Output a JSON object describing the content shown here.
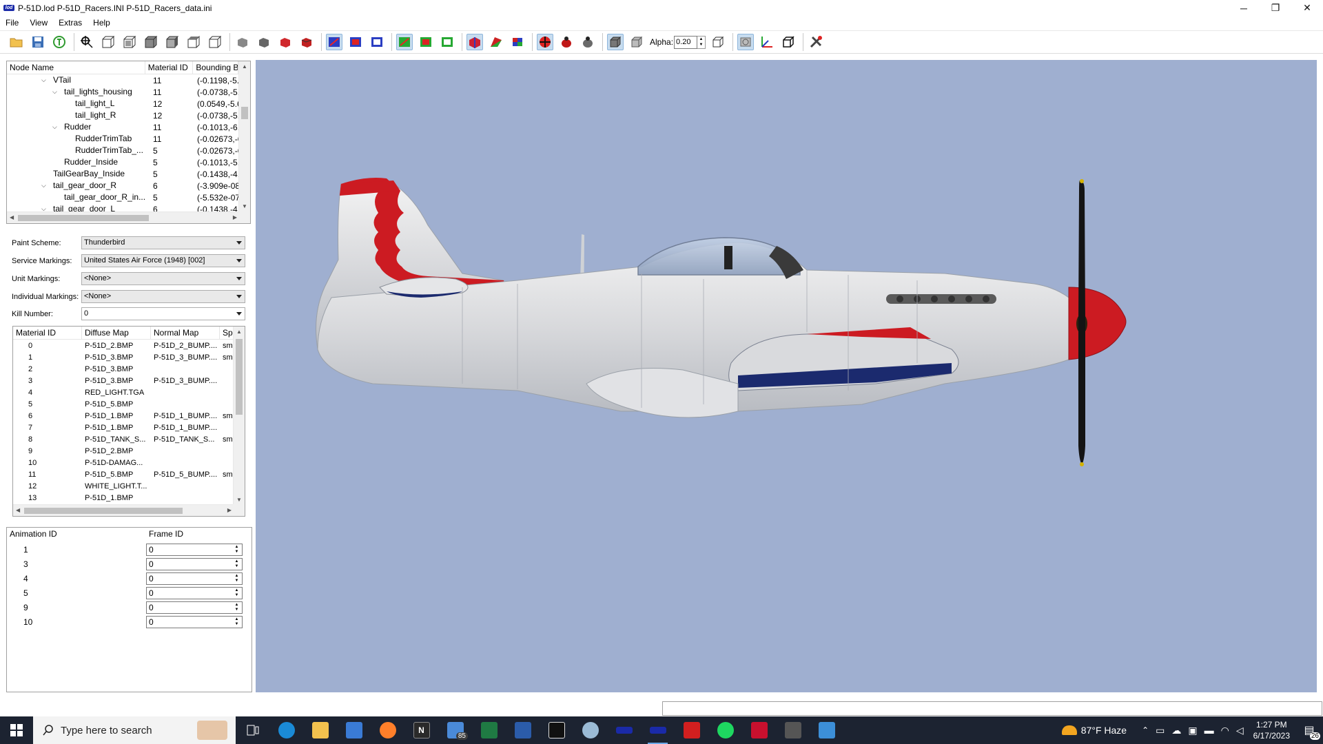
{
  "window": {
    "title": "P-51D.lod  P-51D_Racers.INI  P-51D_Racers_data.ini",
    "minimize": "─",
    "maximize": "❐",
    "close": "✕"
  },
  "menu": [
    "File",
    "View",
    "Extras",
    "Help"
  ],
  "toolbar": {
    "alpha_label": "Alpha:",
    "alpha_value": "0.20"
  },
  "node_tree": {
    "headers": [
      "Node Name",
      "Material ID",
      "Bounding Bo"
    ],
    "rows": [
      {
        "name": "VTail",
        "material": "11",
        "bounds": "(-0.1198,-5.7",
        "depth": 2,
        "expander": "collapse"
      },
      {
        "name": "tail_lights_housing",
        "material": "11",
        "bounds": "(-0.0738,-5.6",
        "depth": 3,
        "expander": "collapse"
      },
      {
        "name": "tail_light_L",
        "material": "12",
        "bounds": "(0.0549,-5.62",
        "depth": 4,
        "expander": "none"
      },
      {
        "name": "tail_light_R",
        "material": "12",
        "bounds": "(-0.0738,-5.6",
        "depth": 4,
        "expander": "none"
      },
      {
        "name": "Rudder",
        "material": "11",
        "bounds": "(-0.1013,-6.4",
        "depth": 3,
        "expander": "collapse"
      },
      {
        "name": "RudderTrimTab",
        "material": "11",
        "bounds": "(-0.02673,-6.",
        "depth": 4,
        "expander": "none"
      },
      {
        "name": "RudderTrimTab_...",
        "material": "5",
        "bounds": "(-0.02673,-6.",
        "depth": 4,
        "expander": "none"
      },
      {
        "name": "Rudder_Inside",
        "material": "5",
        "bounds": "(-0.1013,-5.7",
        "depth": 3,
        "expander": "none"
      },
      {
        "name": "TailGearBay_Inside",
        "material": "5",
        "bounds": "(-0.1438,-4.5",
        "depth": 2,
        "expander": "none"
      },
      {
        "name": "tail_gear_door_R",
        "material": "6",
        "bounds": "(-3.909e-08,-",
        "depth": 2,
        "expander": "collapse"
      },
      {
        "name": "tail_gear_door_R_in...",
        "material": "5",
        "bounds": "(-5.532e-07,-",
        "depth": 3,
        "expander": "none"
      },
      {
        "name": "tail_gear_door_L",
        "material": "6",
        "bounds": "(-0.1438,-4.5",
        "depth": 2,
        "expander": "collapse"
      }
    ]
  },
  "markings": {
    "paint_scheme_label": "Paint Scheme:",
    "paint_scheme_value": "Thunderbird",
    "service_label": "Service Markings:",
    "service_value": "United States Air Force (1948) [002]",
    "unit_label": "Unit Markings:",
    "unit_value": "<None>",
    "individual_label": "Individual Markings:",
    "individual_value": "<None>",
    "kill_label": "Kill Number:",
    "kill_value": "0"
  },
  "materials": {
    "headers": [
      "Material ID",
      "Diffuse Map",
      "Normal Map",
      "Spe"
    ],
    "rows": [
      {
        "id": "0",
        "diffuse": "P-51D_2.BMP",
        "normal": "P-51D_2_BUMP....",
        "spec": "sm"
      },
      {
        "id": "1",
        "diffuse": "P-51D_3.BMP",
        "normal": "P-51D_3_BUMP....",
        "spec": "sm"
      },
      {
        "id": "2",
        "diffuse": "P-51D_3.BMP",
        "normal": "",
        "spec": ""
      },
      {
        "id": "3",
        "diffuse": "P-51D_3.BMP",
        "normal": "P-51D_3_BUMP....",
        "spec": ""
      },
      {
        "id": "4",
        "diffuse": "RED_LIGHT.TGA",
        "normal": "",
        "spec": ""
      },
      {
        "id": "5",
        "diffuse": "P-51D_5.BMP",
        "normal": "",
        "spec": ""
      },
      {
        "id": "6",
        "diffuse": "P-51D_1.BMP",
        "normal": "P-51D_1_BUMP....",
        "spec": "sm"
      },
      {
        "id": "7",
        "diffuse": "P-51D_1.BMP",
        "normal": "P-51D_1_BUMP....",
        "spec": ""
      },
      {
        "id": "8",
        "diffuse": "P-51D_TANK_S...",
        "normal": "P-51D_TANK_S...",
        "spec": "sm"
      },
      {
        "id": "9",
        "diffuse": "P-51D_2.BMP",
        "normal": "",
        "spec": ""
      },
      {
        "id": "10",
        "diffuse": "P-51D-DAMAG...",
        "normal": "",
        "spec": ""
      },
      {
        "id": "11",
        "diffuse": "P-51D_5.BMP",
        "normal": "P-51D_5_BUMP....",
        "spec": "sm"
      },
      {
        "id": "12",
        "diffuse": "WHITE_LIGHT.T...",
        "normal": "",
        "spec": ""
      },
      {
        "id": "13",
        "diffuse": "P-51D_1.BMP",
        "normal": "",
        "spec": ""
      }
    ]
  },
  "animations": {
    "headers": [
      "Animation ID",
      "Frame ID"
    ],
    "rows": [
      {
        "id": "1",
        "frame": "0"
      },
      {
        "id": "3",
        "frame": "0"
      },
      {
        "id": "4",
        "frame": "0"
      },
      {
        "id": "5",
        "frame": "0"
      },
      {
        "id": "9",
        "frame": "0"
      },
      {
        "id": "10",
        "frame": "0"
      }
    ]
  },
  "taskbar": {
    "search_placeholder": "Type here to search",
    "mail_badge": "85",
    "weather": "87°F  Haze",
    "time": "1:27 PM",
    "date": "6/17/2023",
    "notification_count": "26"
  }
}
